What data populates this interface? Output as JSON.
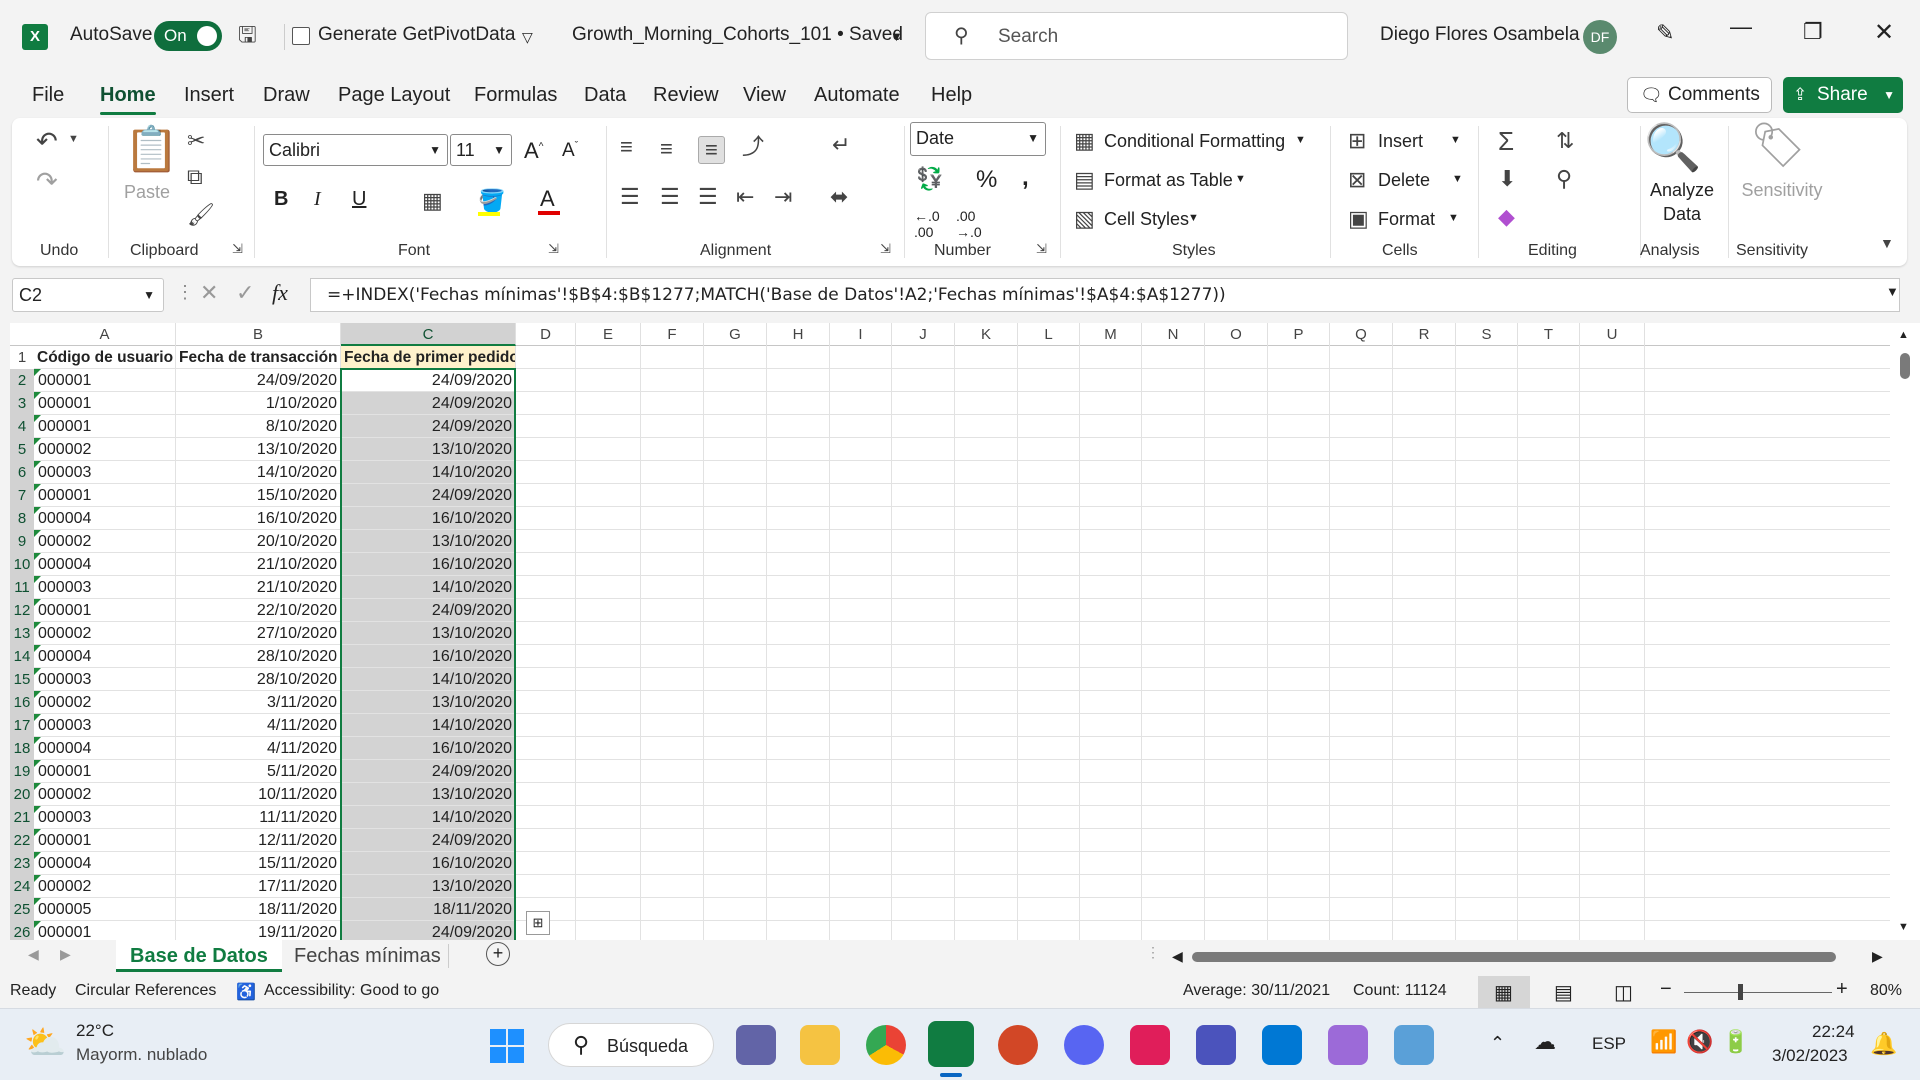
{
  "titlebar": {
    "autosave_label": "AutoSave",
    "autosave_state": "On",
    "getpivot_label": "Generate GetPivotData",
    "doc_title": "Growth_Morning_Cohorts_101 • Saved",
    "search_placeholder": "Search",
    "user_name": "Diego Flores Osambela",
    "user_initials": "DF"
  },
  "menu": {
    "items": [
      "File",
      "Home",
      "Insert",
      "Draw",
      "Page Layout",
      "Formulas",
      "Data",
      "Review",
      "View",
      "Automate",
      "Help"
    ],
    "comments_label": "Comments",
    "share_label": "Share"
  },
  "ribbon": {
    "groups": {
      "undo": "Undo",
      "clipboard": "Clipboard",
      "font": "Font",
      "alignment": "Alignment",
      "number": "Number",
      "styles": "Styles",
      "cells": "Cells",
      "editing": "Editing",
      "analysis": "Analysis",
      "sensitivity": "Sensitivity"
    },
    "paste_label": "Paste",
    "font_name": "Calibri",
    "font_size": "11",
    "number_format": "Date",
    "conditional_formatting": "Conditional Formatting",
    "format_as_table": "Format as Table",
    "cell_styles": "Cell Styles",
    "insert": "Insert",
    "delete": "Delete",
    "format": "Format",
    "analyze_data": "Analyze Data",
    "sensitivity_btn": "Sensitivity"
  },
  "formula_bar": {
    "name_box": "C2",
    "formula": "=+INDEX('Fechas mínimas'!$B$4:$B$1277;MATCH('Base de Datos'!A2;'Fechas mínimas'!$A$4:$A$1277))"
  },
  "grid": {
    "columns": [
      "A",
      "B",
      "C",
      "D",
      "E",
      "F",
      "G",
      "H",
      "I",
      "J",
      "K",
      "L",
      "M",
      "N",
      "O",
      "P",
      "Q",
      "R",
      "S",
      "T",
      "U"
    ],
    "headers": [
      "Código de usuario",
      "Fecha de transacción",
      "Fecha de primer pedido"
    ],
    "rows": [
      [
        "000001",
        "24/09/2020",
        "24/09/2020"
      ],
      [
        "000001",
        "1/10/2020",
        "24/09/2020"
      ],
      [
        "000001",
        "8/10/2020",
        "24/09/2020"
      ],
      [
        "000002",
        "13/10/2020",
        "13/10/2020"
      ],
      [
        "000003",
        "14/10/2020",
        "14/10/2020"
      ],
      [
        "000001",
        "15/10/2020",
        "24/09/2020"
      ],
      [
        "000004",
        "16/10/2020",
        "16/10/2020"
      ],
      [
        "000002",
        "20/10/2020",
        "13/10/2020"
      ],
      [
        "000004",
        "21/10/2020",
        "16/10/2020"
      ],
      [
        "000003",
        "21/10/2020",
        "14/10/2020"
      ],
      [
        "000001",
        "22/10/2020",
        "24/09/2020"
      ],
      [
        "000002",
        "27/10/2020",
        "13/10/2020"
      ],
      [
        "000004",
        "28/10/2020",
        "16/10/2020"
      ],
      [
        "000003",
        "28/10/2020",
        "14/10/2020"
      ],
      [
        "000002",
        "3/11/2020",
        "13/10/2020"
      ],
      [
        "000003",
        "4/11/2020",
        "14/10/2020"
      ],
      [
        "000004",
        "4/11/2020",
        "16/10/2020"
      ],
      [
        "000001",
        "5/11/2020",
        "24/09/2020"
      ],
      [
        "000002",
        "10/11/2020",
        "13/10/2020"
      ],
      [
        "000003",
        "11/11/2020",
        "14/10/2020"
      ],
      [
        "000001",
        "12/11/2020",
        "24/09/2020"
      ],
      [
        "000004",
        "15/11/2020",
        "16/10/2020"
      ],
      [
        "000002",
        "17/11/2020",
        "13/10/2020"
      ],
      [
        "000005",
        "18/11/2020",
        "18/11/2020"
      ],
      [
        "000001",
        "19/11/2020",
        "24/09/2020"
      ]
    ]
  },
  "sheets": {
    "active": "Base de Datos",
    "other": "Fechas mínimas"
  },
  "status": {
    "ready": "Ready",
    "circular": "Circular References",
    "accessibility": "Accessibility: Good to go",
    "average": "Average: 30/11/2021",
    "count": "Count: 11124",
    "zoom": "80%"
  },
  "taskbar": {
    "temp": "22°C",
    "weather": "Mayorm. nublado",
    "search": "Búsqueda",
    "lang": "ESP",
    "time": "22:24",
    "date": "3/02/2023"
  },
  "colors": {
    "excel_green": "#107c41",
    "selection_grey": "#d3d3d3",
    "header_fill": "#fff2cc"
  }
}
